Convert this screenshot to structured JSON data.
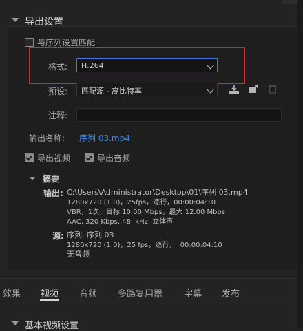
{
  "export_settings": {
    "title": "导出设置",
    "match_sequence_label": "与序列设置匹配",
    "format_label": "格式:",
    "format_value": "H.264",
    "preset_label": "预设:",
    "preset_value": "匹配源 - 高比特率",
    "comment_label": "注释:",
    "comment_value": "",
    "output_name_label": "输出名称:",
    "output_name_value": "序列 03.mp4",
    "export_video_label": "导出视频",
    "export_audio_label": "导出音频",
    "export_video_checked": true,
    "export_audio_checked": true,
    "match_sequence_checked": false
  },
  "summary": {
    "title": "摘要",
    "output_key": "输出:",
    "output_lines": [
      "C:\\Users\\Administrator\\Desktop\\01\\序列 03.mp4",
      "1280x720 (1.0)，25fps，逐行，00:00:04:10",
      "VBR，1次，目标 10.00 Mbps，最大 12.00 Mbps",
      "AAC, 320 Kbps, 48  kHz, 立体声"
    ],
    "source_key": "源:",
    "source_lines": [
      "序列, 序列 03",
      "1280x720 (1.0)，25 fps，逐行，  00:00:04:10",
      "无音频"
    ]
  },
  "tabs": [
    {
      "label": "效果",
      "active": false
    },
    {
      "label": "视频",
      "active": true
    },
    {
      "label": "音频",
      "active": false
    },
    {
      "label": "多路复用器",
      "active": false
    },
    {
      "label": "字幕",
      "active": false
    },
    {
      "label": "发布",
      "active": false
    }
  ],
  "bottom_section": {
    "title": "基本视频设置"
  },
  "colors": {
    "accent": "#2d8ceb",
    "highlight": "#e0252a",
    "focus": "#3b78d8"
  }
}
